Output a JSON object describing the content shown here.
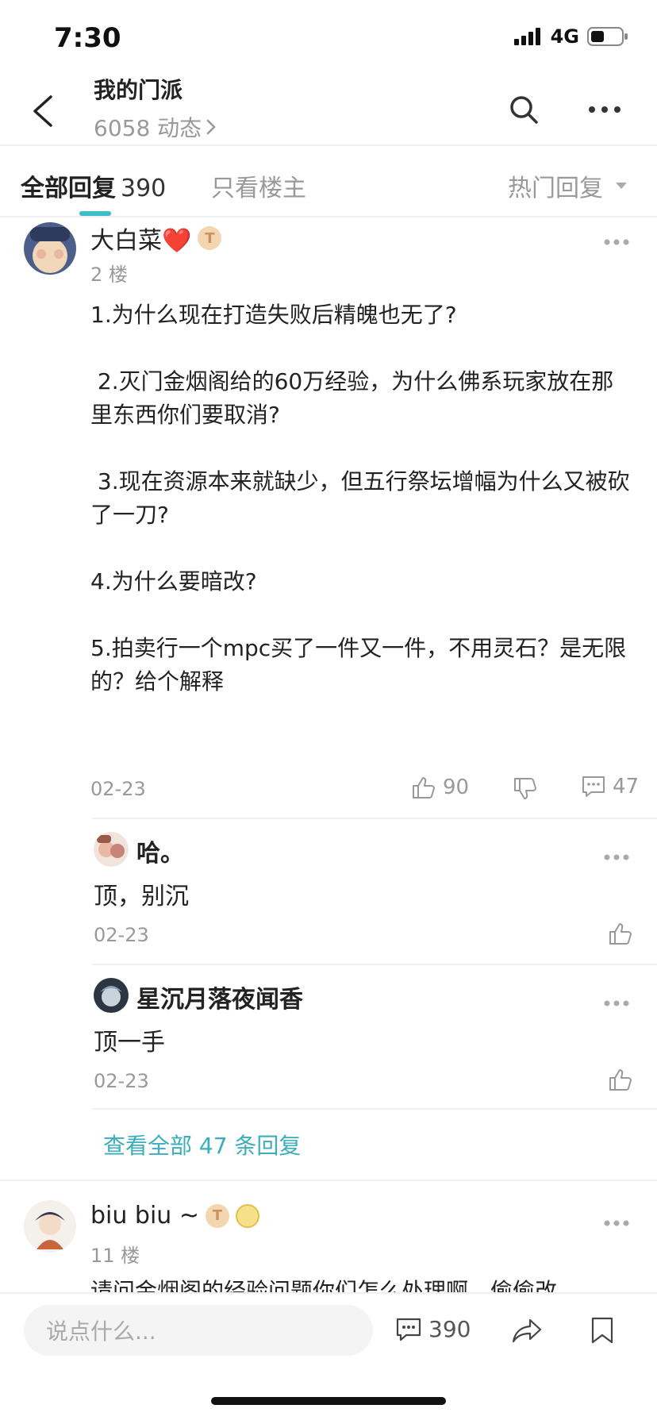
{
  "status_bar": {
    "time": "7:30",
    "network": "4G"
  },
  "nav": {
    "title": "我的门派",
    "subtitle": "6058 动态"
  },
  "tabs": {
    "all_label": "全部回复",
    "all_count": "390",
    "owner_only": "只看楼主",
    "sort": "热门回复"
  },
  "post": {
    "username": "大白菜❤️",
    "badge": "T",
    "floor": "2 楼",
    "paragraphs": [
      "1.为什么现在打造失败后精魄也无了?",
      " 2.灭门金烟阁给的60万经验，为什么佛系玩家放在那里东西你们要取消?",
      " 3.现在资源本来就缺少，但五行祭坛增幅为什么又被砍了一刀?",
      "4.为什么要暗改?",
      "5.拍卖行一个mpc买了一件又一件，不用灵石？是无限的？给个解释"
    ],
    "date": "02-23",
    "likes": "90",
    "comments": "47"
  },
  "replies": [
    {
      "name": "哈。",
      "text": "顶，别沉",
      "date": "02-23"
    },
    {
      "name": "星沉月落夜闻香",
      "text": "顶一手",
      "date": "02-23"
    }
  ],
  "view_all": "查看全部 47 条回复",
  "next_post": {
    "username": "biu  biu  ~",
    "badge": "T",
    "floor": "11 楼",
    "preview": "请问金烟阁的经验问题你们怎么处理啊，偷偷改"
  },
  "bottom_bar": {
    "placeholder": "说点什么...",
    "comment_count": "390"
  },
  "colors": {
    "accent": "#3dbdc8",
    "link": "#3aaeba",
    "muted": "#999999"
  },
  "icons": [
    "back-icon",
    "search-icon",
    "more-icon",
    "chevron-right-icon",
    "dropdown-icon",
    "thumb-up-icon",
    "thumb-down-icon",
    "comment-icon",
    "share-icon",
    "bookmark-icon"
  ]
}
